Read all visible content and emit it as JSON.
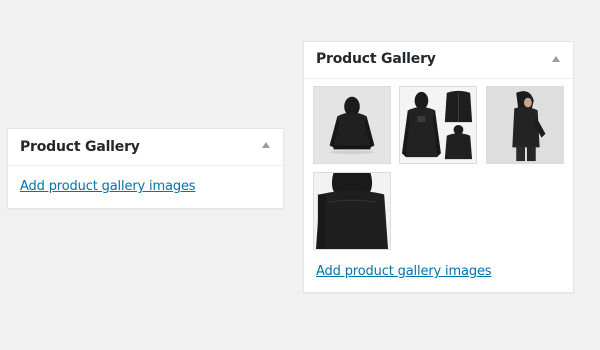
{
  "left_panel": {
    "title": "Product Gallery",
    "add_link": "Add product gallery images",
    "toggle_icon": "triangle-up-icon"
  },
  "right_panel": {
    "title": "Product Gallery",
    "add_link": "Add product gallery images",
    "toggle_icon": "triangle-up-icon",
    "images": [
      {
        "name": "black hoodie back view"
      },
      {
        "name": "black hoodie and jacket collage"
      },
      {
        "name": "model wearing black hoodie side view"
      },
      {
        "name": "black hoodie back close-up"
      }
    ]
  },
  "colors": {
    "background": "#f1f1f1",
    "panel": "#ffffff",
    "link": "#0073aa",
    "title": "#23282d"
  }
}
